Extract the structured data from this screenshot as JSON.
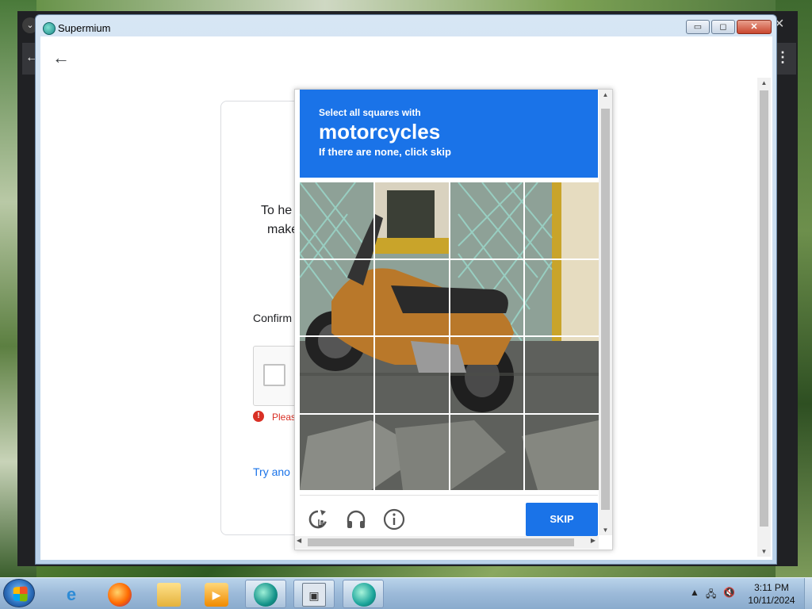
{
  "window": {
    "title": "Supermium",
    "buttons": {
      "minimize": "▭",
      "maximize": "◻",
      "close": "✕"
    }
  },
  "google_page": {
    "line1": "To he",
    "line2": "make",
    "confirm_label": "Confirm",
    "error_text": "Pleas",
    "error_icon": "!",
    "link_text": "Try ano"
  },
  "captcha": {
    "instruction_small": "Select all squares with",
    "target": "motorcycles",
    "instruction_sub": "If there are none, click skip",
    "grid": {
      "rows": 4,
      "cols": 4
    },
    "skip_label": "SKIP",
    "icons": {
      "reload": "reload-icon",
      "audio": "headphones-icon",
      "info": "info-icon"
    }
  },
  "taskbar": {
    "clock_time": "3:11 PM",
    "clock_date": "10/11/2024"
  }
}
